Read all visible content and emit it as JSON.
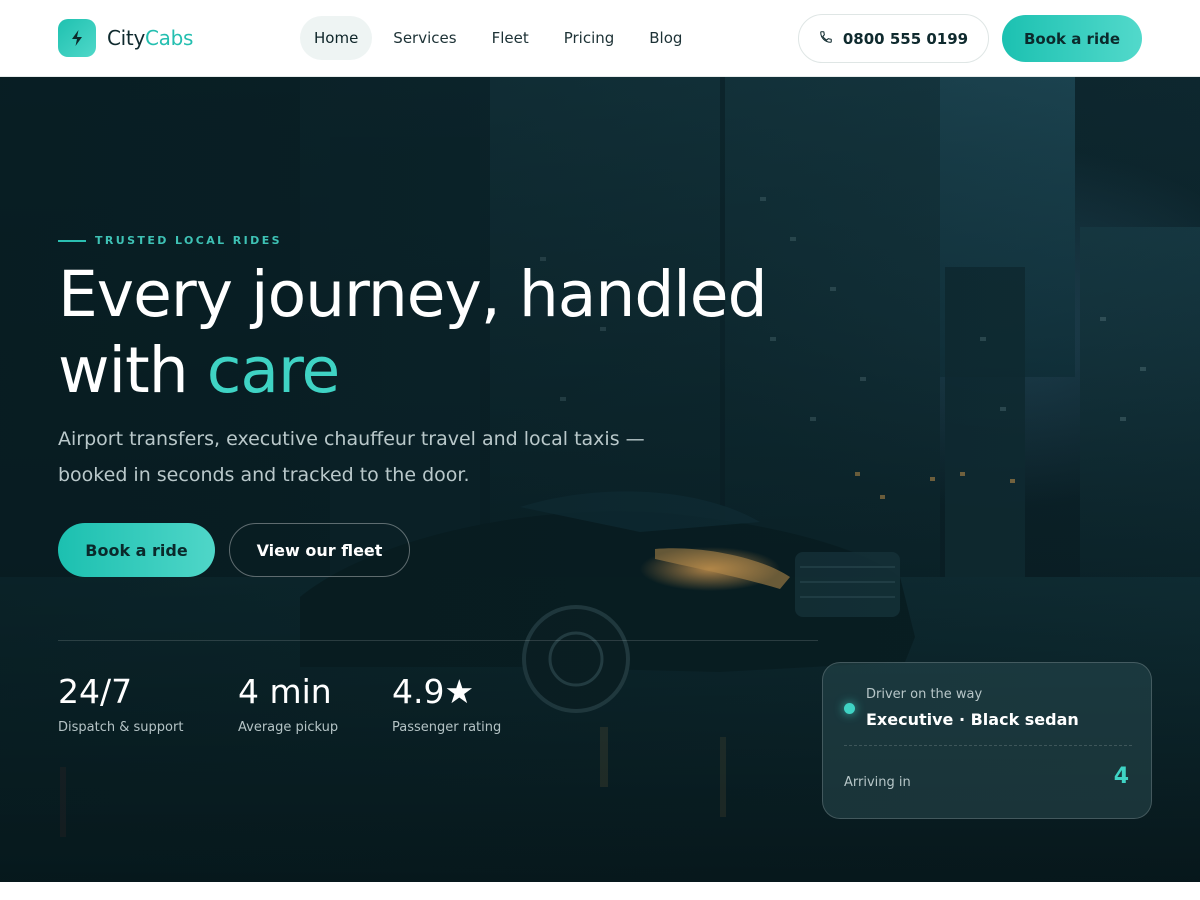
{
  "brand": {
    "name_part1": "City",
    "name_part2": "Cabs",
    "logo_icon": "bolt-icon"
  },
  "nav": {
    "items": [
      {
        "label": "Home",
        "active": true
      },
      {
        "label": "Services",
        "active": false
      },
      {
        "label": "Fleet",
        "active": false
      },
      {
        "label": "Pricing",
        "active": false
      },
      {
        "label": "Blog",
        "active": false
      }
    ],
    "phone": {
      "icon": "phone-icon",
      "number": "0800 555 0199"
    },
    "cta_label": "Book a ride"
  },
  "hero": {
    "eyebrow": "TRUSTED LOCAL RIDES",
    "headline_part1": "Every journey, handled",
    "headline_part2": "with",
    "headline_accent": "care",
    "subtext": "Airport transfers, executive chauffeur travel and local taxis — booked in seconds and tracked to the door.",
    "primary_cta": "Book a ride",
    "secondary_cta": "View our fleet",
    "stats": [
      {
        "value": "24/7",
        "label": "Dispatch & support"
      },
      {
        "value": "4 min",
        "label": "Average pickup"
      },
      {
        "value": "4.9★",
        "label": "Passenger rating"
      }
    ]
  },
  "status_card": {
    "kicker": "Driver on the way",
    "title": "Executive · Black sedan",
    "arriving_label": "Arriving in",
    "arriving_value": "4"
  },
  "colors": {
    "accent": "#24bfb0",
    "accent_light": "#3fd3c4",
    "hero_bg": "#0b2128",
    "text_dark": "#0f2a2e"
  }
}
